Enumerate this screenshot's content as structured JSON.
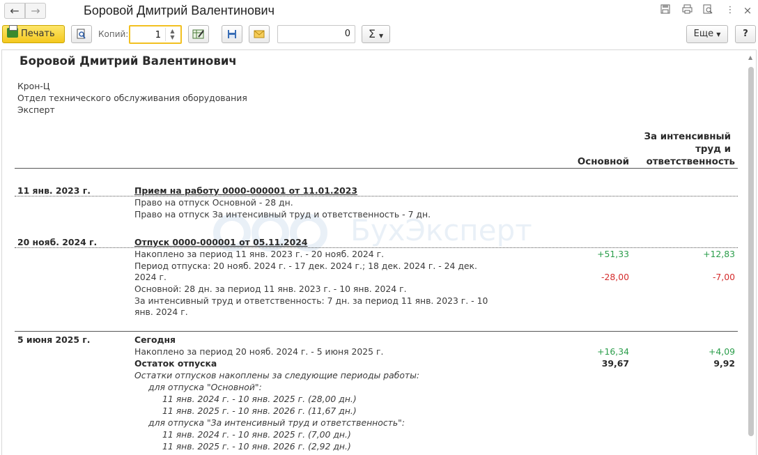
{
  "window": {
    "title": "Боровой Дмитрий Валентинович",
    "icons": [
      "save-icon",
      "print-icon",
      "preview-icon",
      "more-vertical-icon",
      "close-icon"
    ]
  },
  "toolbar": {
    "print_label": "Печать",
    "copies_label": "Копий:",
    "copies_value": "1",
    "number_value": "0",
    "sum_label": "Σ",
    "more_label": "Еще",
    "help_label": "?"
  },
  "report": {
    "title": "Боровой Дмитрий Валентинович",
    "org": "Крон-Ц",
    "department": "Отдел технического обслуживания оборудования",
    "position": "Эксперт",
    "col_main": "Основной",
    "col_extra_1": "За интенсивный",
    "col_extra_2": "труд и",
    "col_extra_3": "ответственность",
    "watermark": "БухЭксперт",
    "sections": [
      {
        "date": "11 янв. 2023 г.",
        "doc": "Прием на работу 0000-000001 от 11.01.2023",
        "lines": [
          "Право на отпуск Основной - 28 дн.",
          "Право на отпуск За интенсивный труд и ответственность - 7 дн."
        ]
      },
      {
        "date": "20 нояб. 2024 г.",
        "doc": "Отпуск 0000-000001 от 05.11.2024",
        "lines": [
          "Накоплено за период 11 янв. 2023 г. - 20 нояб. 2024 г.",
          "Период отпуска: 20 нояб. 2024 г. - 17 дек. 2024 г.; 18 дек. 2024 г. - 24 дек.",
          "2024 г.",
          "Основной: 28 дн. за период 11 янв. 2023 г. - 10 янв. 2024 г.",
          "За интенсивный труд и ответственность: 7 дн. за период 11 янв. 2023 г. - 10",
          "янв. 2024 г."
        ],
        "accrued_main": "+51,33",
        "accrued_extra": "+12,83",
        "used_main": "-28,00",
        "used_extra": "-7,00"
      },
      {
        "date": "5 июня 2025 г.",
        "doc": "Сегодня",
        "lines": [
          "Накоплено за период 20 нояб. 2024 г. - 5 июня 2025 г."
        ],
        "accrued_main": "+16,34",
        "accrued_extra": "+4,09",
        "balance_label": "Остаток отпуска",
        "balance_main": "39,67",
        "balance_extra": "9,92",
        "remain_header": "Остатки отпусков накоплены за следующие периоды работы:",
        "remain_main_label": "для отпуска \"Основной\":",
        "remain_main_items": [
          "11 янв. 2024 г. - 10 янв. 2025 г. (28,00 дн.)",
          "11 янв. 2025 г. - 10 янв. 2026 г. (11,67 дн.)"
        ],
        "remain_extra_label": "для отпуска \"За интенсивный труд и ответственность\":",
        "remain_extra_items": [
          "11 янв. 2024 г. - 10 янв. 2025 г. (7,00 дн.)",
          "11 янв. 2025 г. - 10 янв. 2026 г. (2,92 дн.)"
        ]
      }
    ]
  }
}
